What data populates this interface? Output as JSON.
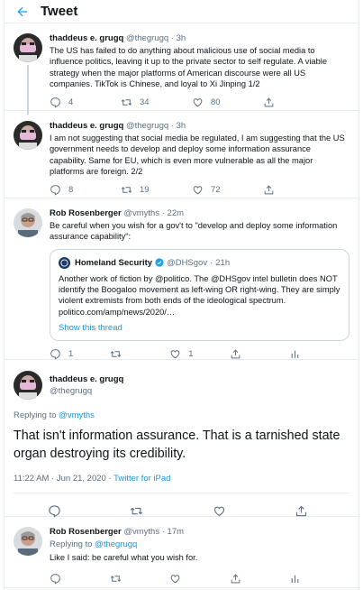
{
  "header": {
    "title": "Tweet"
  },
  "tweets": [
    {
      "name": "thaddeus e. grugq",
      "handle": "@thegrugq",
      "sep": "·",
      "time": "3h",
      "text": "The US has failed to do anything about malicious use of social media to influence politics, leaving it up to the private sector to self regulate. A viable strategy when the major platforms of American discourse were all US companies. TikTok is Chinese, and loyal to Xi Jinping 1/2",
      "replies": "4",
      "retweets": "34",
      "likes": "80"
    },
    {
      "name": "thaddeus e. grugq",
      "handle": "@thegrugq",
      "sep": "·",
      "time": "3h",
      "text": "I am not suggesting that social media be regulated, I am suggesting that the US government needs to develop and deploy some information assurance capability. Same for EU, which is even more vulnerable as all the major platforms are foreign. 2/2",
      "replies": "8",
      "retweets": "19",
      "likes": "72"
    },
    {
      "name": "Rob Rosenberger",
      "handle": "@vmyths",
      "sep": "·",
      "time": "22m",
      "text": "Be careful when you wish for a gov't to \"develop and deploy some information assurance capability\":",
      "replies": "1",
      "retweets": "",
      "likes": "1",
      "quote": {
        "name": "Homeland Security",
        "handle": "@DHSgov",
        "sep": "·",
        "time": "21h",
        "text": "Another work of fiction by @politico. The @DHSgov intel bulletin does NOT identify the Boogaloo movement as left-wing OR right-wing. They are simply violent extremists from both ends of the ideological spectrum.",
        "link": "politico.com/amp/news/2020/…",
        "show_thread": "Show this thread"
      }
    }
  ],
  "main_tweet": {
    "name": "thaddeus e. grugq",
    "handle": "@thegrugq",
    "replying_label": "Replying to",
    "replying_to": "@vmyths",
    "text": "That isn't information assurance. That is a tarnished state organ destroying its credibility.",
    "timestamp": "11:22 AM · Jun 21, 2020 · ",
    "source": "Twitter for iPad"
  },
  "reply": {
    "name": "Rob Rosenberger",
    "handle": "@vmyths",
    "sep": "·",
    "time": "17m",
    "replying_label": "Replying to",
    "replying_to": "@thegrugq",
    "text": "Like I said: be careful what you wish for."
  },
  "colors": {
    "accent": "#1da1f2",
    "link": "#1b95e0",
    "muted": "#5b7083",
    "border": "#e6ecf0"
  }
}
